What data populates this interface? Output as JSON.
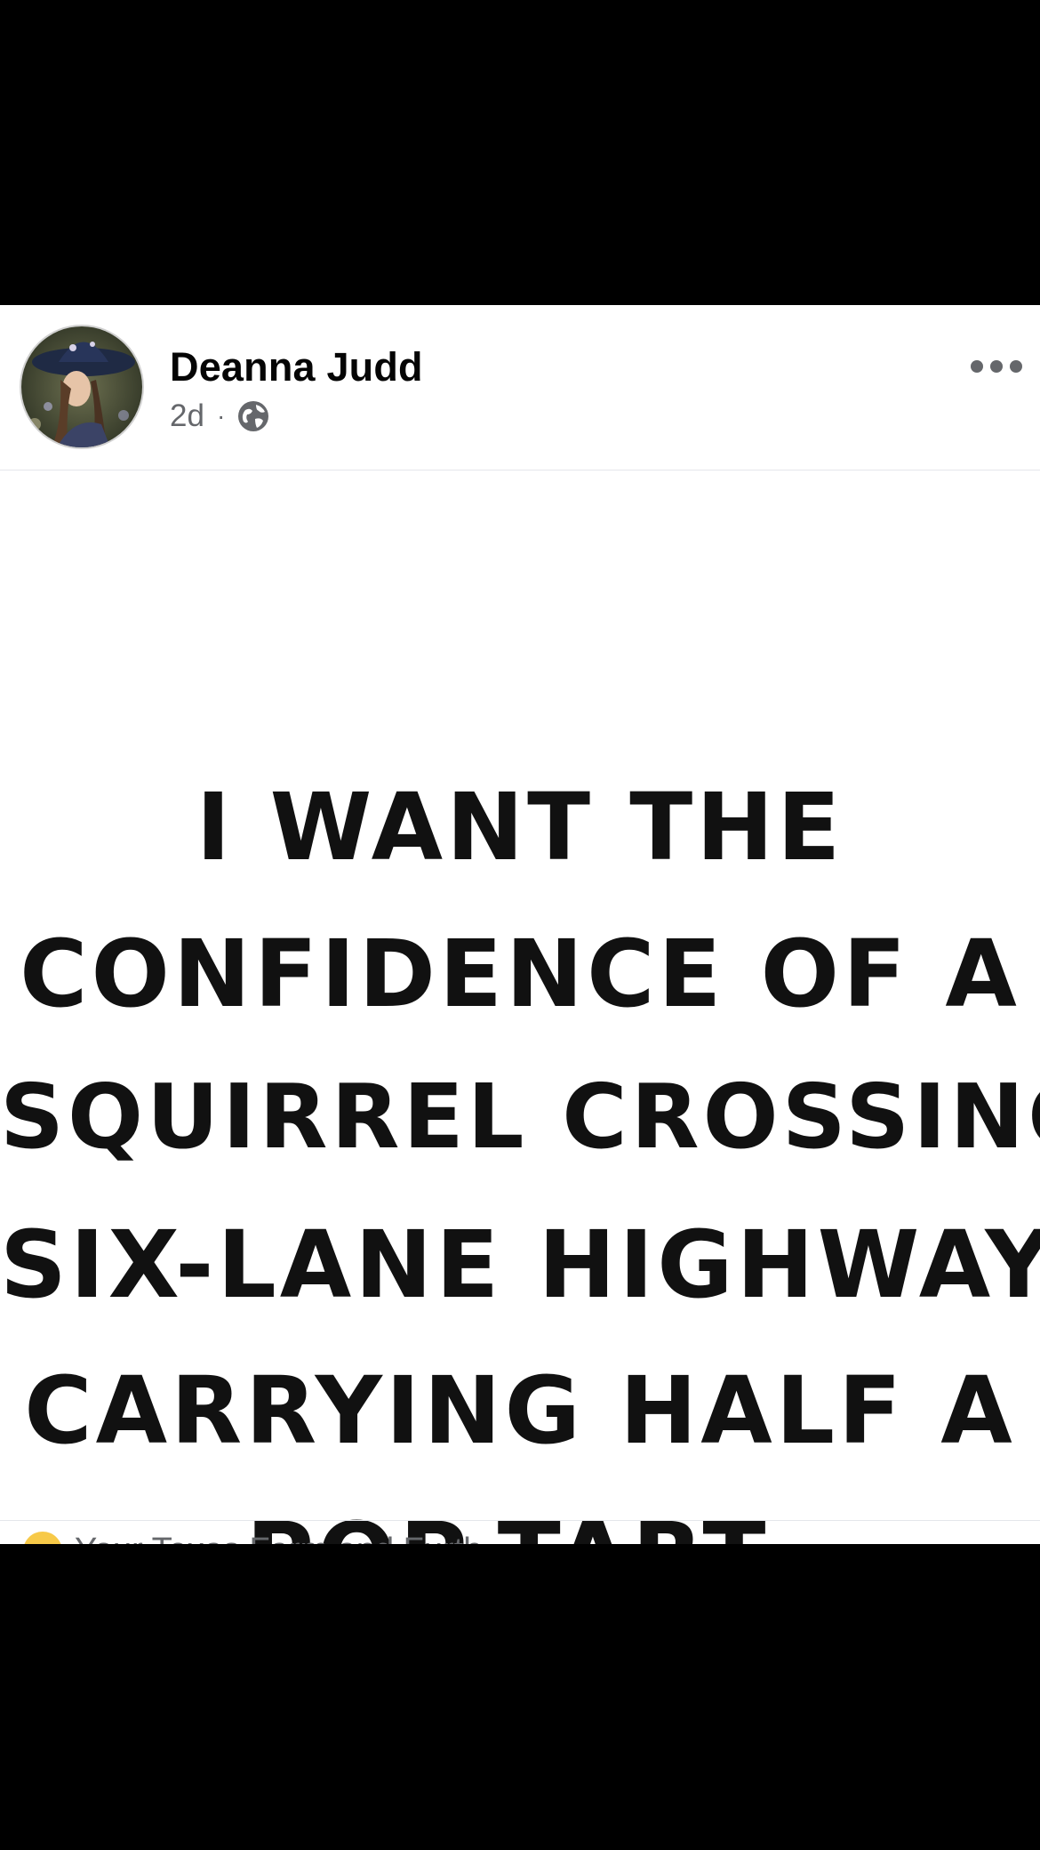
{
  "post": {
    "author_name": "Deanna Judd",
    "timestamp": "2d",
    "separator": "·",
    "audience_icon": "globe-icon",
    "avatar_icon": "profile-photo-woman-in-hat",
    "more_icon": "more-options-icon"
  },
  "image": {
    "lines": [
      "I WANT THE",
      "CONFIDENCE OF A",
      "SQUIRREL CROSSING A",
      "SIX-LANE HIGHWAY",
      "CARRYING HALF A",
      "POP-TART."
    ]
  },
  "reactions": {
    "emoji_icon": "reaction-emoji-icon",
    "names_partial": "Your Texas Farm and Furth..."
  },
  "colors": {
    "background": "#000000",
    "card": "#ffffff",
    "author": "#050505",
    "meta": "#65676b",
    "quote": "#111111"
  }
}
